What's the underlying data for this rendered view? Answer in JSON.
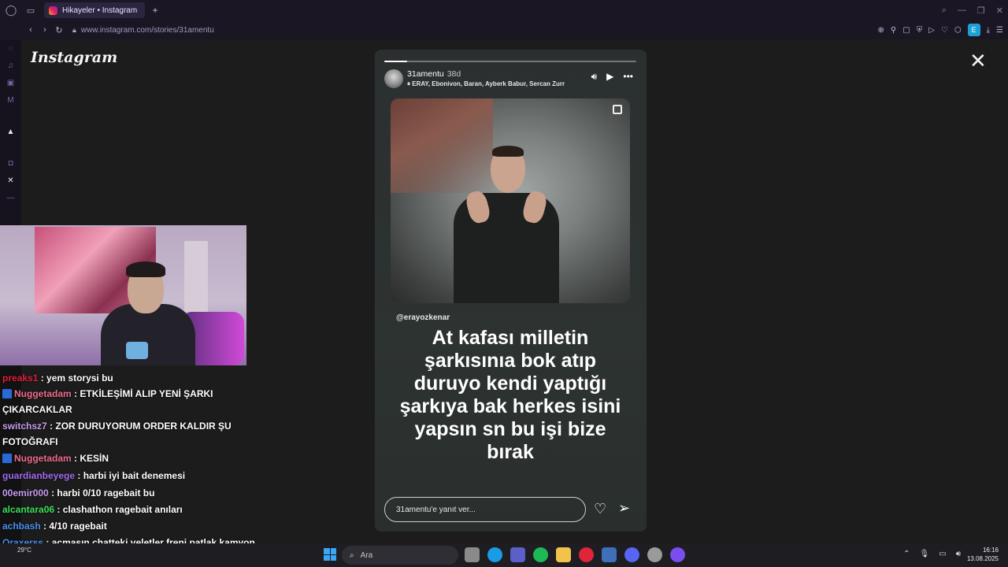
{
  "browser": {
    "tab_title": "Hikayeler • Instagram",
    "new_tab": "+",
    "url": "www.instagram.com/stories/31amentu",
    "extension_badge": "E"
  },
  "instagram": {
    "logo": "Instagram",
    "story": {
      "progress": 0.09,
      "username": "31amentu",
      "age": "38d",
      "music": "ERAY, Ebonivon, Baran, Ayberk Babur, Sercan Zurr",
      "mention": "@erayozkenar",
      "caption": "At kafası milletin şarkısınıa bok atıp duruyo kendi yaptığı şarkıya bak herkes isini yapsın sn bu işi bize bırak",
      "reply_placeholder": "31amentu'e yanıt ver..."
    }
  },
  "chat": {
    "messages": [
      {
        "user": "preaks1",
        "text": ": yem storysi bu",
        "color": "#e0203a",
        "badge": false
      },
      {
        "user": "Nuggetadam",
        "text": ": ETKİLEŞİMİ ALIP YENİ ŞARKI ÇIKARCAKLAR",
        "color": "#f06c8c",
        "badge": true
      },
      {
        "user": "switchsz7",
        "text": ": ZOR DURUYORUM ORDER KALDIR ŞU FOTOĞRAFI",
        "color": "#c79cf0",
        "badge": false
      },
      {
        "user": "Nuggetadam",
        "text": ": KESİN",
        "color": "#f06c8c",
        "badge": true
      },
      {
        "user": "guardianbeyege",
        "text": ": harbi iyi bait denemesi",
        "color": "#a46cf0",
        "badge": false
      },
      {
        "user": "00emir000",
        "text": ": harbi 0/10 ragebait bu",
        "color": "#c79cf0",
        "badge": false
      },
      {
        "user": "alcantara06",
        "text": ": clashathon ragebait anıları",
        "color": "#3ce05a",
        "badge": false
      },
      {
        "user": "achbash",
        "text": ": 4/10 ragebait",
        "color": "#4a90f0",
        "badge": false
      },
      {
        "user": "Qraxerss",
        "text": ": açmasın chatteki veletler freni patlak kamyon gibi girer",
        "color": "#4a90f0",
        "badge": false
      }
    ]
  },
  "taskbar": {
    "weather_temp": "29°C",
    "search_placeholder": "Ara",
    "time": "16:16",
    "date": "13.08.2025"
  }
}
